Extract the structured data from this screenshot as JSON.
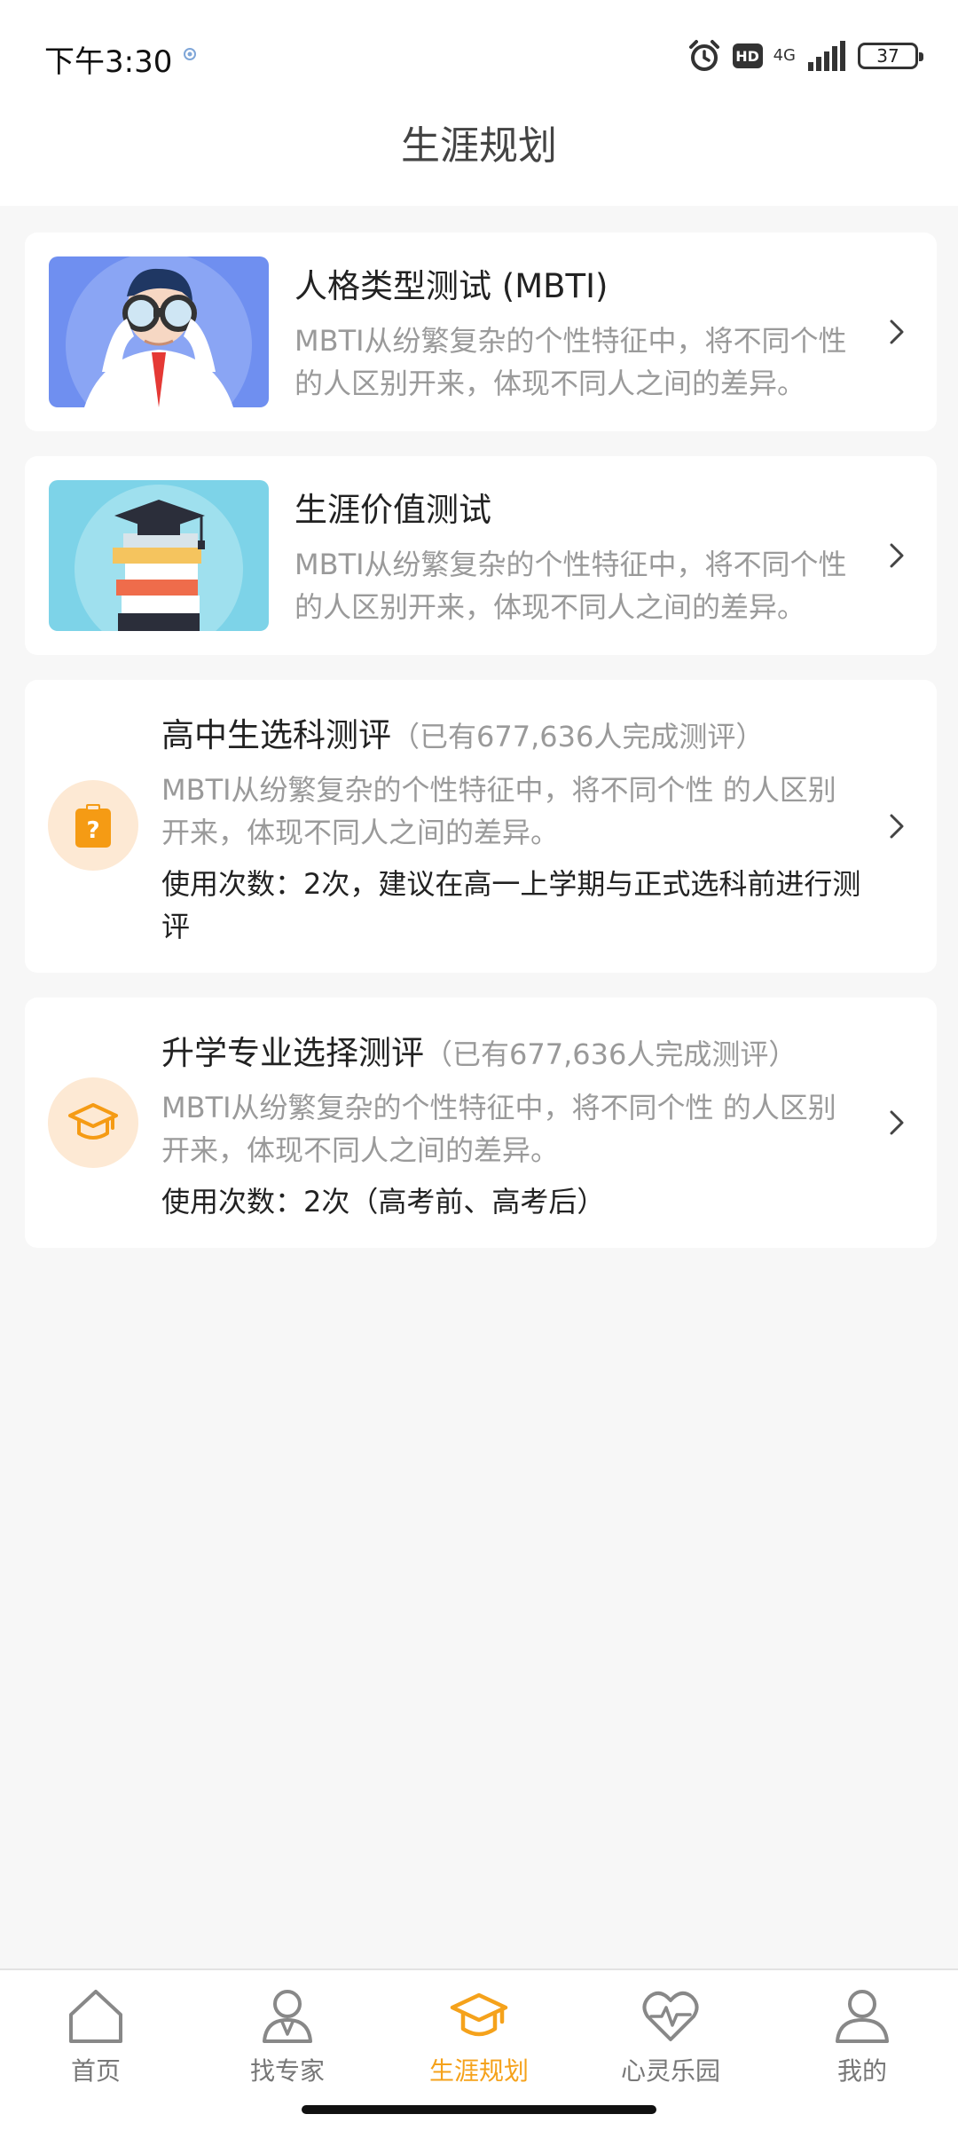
{
  "status_bar": {
    "time": "下午3:30",
    "hd": "HD",
    "network": "4G",
    "battery": "37",
    "icons": [
      "location-icon",
      "alarm-icon",
      "signal-icon",
      "battery-icon"
    ]
  },
  "header": {
    "title": "生涯规划"
  },
  "cards": [
    {
      "title": "人格类型测试 (MBTI)",
      "description": "MBTI从纷繁复杂的个性特征中，将不同个性 的人区别开来，体现不同人之间的差异。",
      "image": "binoculars-person-illustration"
    },
    {
      "title": "生涯价值测试",
      "description": "MBTI从纷繁复杂的个性特征中，将不同个性 的人区别开来，体现不同人之间的差异。",
      "image": "graduation-cap-books-illustration"
    },
    {
      "title": "高中生选科测评",
      "count_note": "（已有677,636人完成测评）",
      "description": "MBTI从纷繁复杂的个性特征中，将不同个性 的人区别开来，体现不同人之间的差异。",
      "usage": "使用次数：2次，建议在高一上学期与正式选科前进行测评",
      "icon": "question-clipboard-icon"
    },
    {
      "title": "升学专业选择测评",
      "count_note": "（已有677,636人完成测评）",
      "description": "MBTI从纷繁复杂的个性特征中，将不同个性 的人区别开来，体现不同人之间的差异。",
      "usage": "使用次数：2次（高考前、高考后）",
      "icon": "graduation-cap-icon"
    }
  ],
  "bottom_nav": {
    "items": [
      {
        "label": "首页",
        "icon": "home-icon",
        "active": false
      },
      {
        "label": "找专家",
        "icon": "expert-icon",
        "active": false
      },
      {
        "label": "生涯规划",
        "icon": "graduation-cap-icon",
        "active": true
      },
      {
        "label": "心灵乐园",
        "icon": "heart-pulse-icon",
        "active": false
      },
      {
        "label": "我的",
        "icon": "user-icon",
        "active": false
      }
    ]
  },
  "colors": {
    "accent": "#f5a21b",
    "background": "#f7f7f7",
    "card": "#ffffff",
    "muted_text": "#9a9a9a",
    "icon_circle": "#fde9d4"
  }
}
